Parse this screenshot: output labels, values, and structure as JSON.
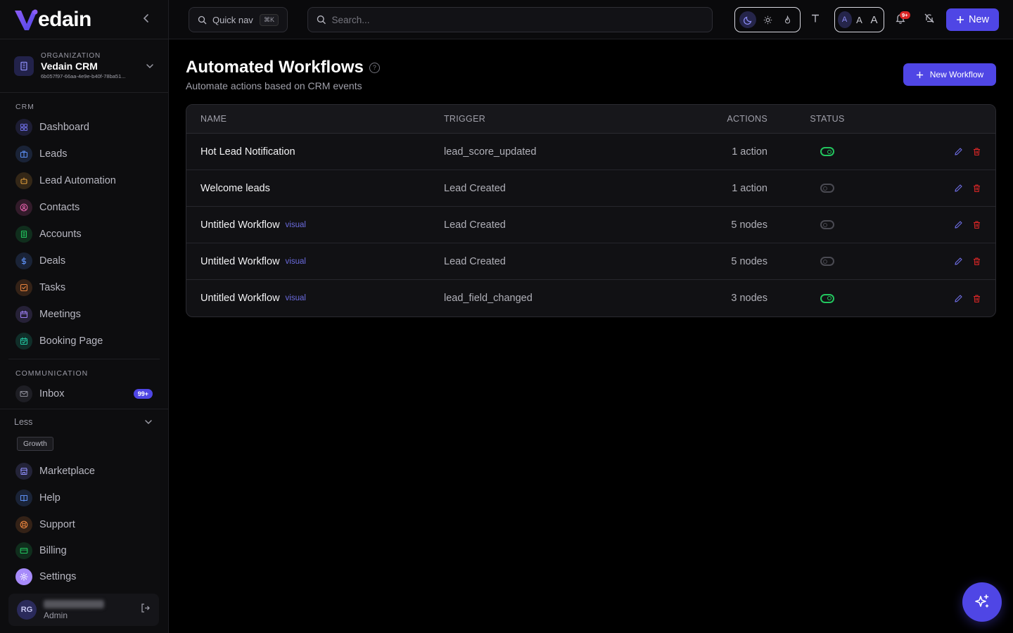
{
  "brand": {
    "name": "edain"
  },
  "organization": {
    "label": "ORGANIZATION",
    "name": "Vedain CRM",
    "id": "6b057f97-66aa-4e9e-b40f-78ba51..."
  },
  "sidebar": {
    "crm_label": "CRM",
    "crm_items": [
      {
        "label": "Dashboard",
        "icon": "grid-icon",
        "color": "#6b6bdf"
      },
      {
        "label": "Leads",
        "icon": "briefcase-icon",
        "color": "#5b8def"
      },
      {
        "label": "Lead Automation",
        "icon": "robot-icon",
        "color": "#e8a33d"
      },
      {
        "label": "Contacts",
        "icon": "user-circle-icon",
        "color": "#e05ea8"
      },
      {
        "label": "Accounts",
        "icon": "building-icon",
        "color": "#22c55e"
      },
      {
        "label": "Deals",
        "icon": "dollar-icon",
        "color": "#5b8def"
      },
      {
        "label": "Tasks",
        "icon": "checkbox-icon",
        "color": "#e8833d"
      },
      {
        "label": "Meetings",
        "icon": "calendar-icon",
        "color": "#9b7df0"
      },
      {
        "label": "Booking Page",
        "icon": "calendar-check-icon",
        "color": "#22c5a0"
      }
    ],
    "comm_label": "COMMUNICATION",
    "inbox": {
      "label": "Inbox",
      "badge": "99+",
      "color": "#8a8a95"
    },
    "less_label": "Less",
    "tag": "Growth",
    "bottom_items": [
      {
        "label": "Marketplace",
        "icon": "store-icon",
        "color": "#8b8bf5"
      },
      {
        "label": "Help",
        "icon": "book-icon",
        "color": "#5b8def"
      },
      {
        "label": "Support",
        "icon": "lifebuoy-icon",
        "color": "#e8833d"
      },
      {
        "label": "Billing",
        "icon": "credit-card-icon",
        "color": "#22c55e"
      },
      {
        "label": "Settings",
        "icon": "gear-icon",
        "color": "#a78bfa"
      }
    ],
    "user": {
      "initials": "RG",
      "role": "Admin"
    }
  },
  "topbar": {
    "quicknav_label": "Quick nav",
    "quicknav_kbd": "⌘K",
    "search_placeholder": "Search...",
    "size_options": [
      "A",
      "A",
      "A"
    ],
    "bell_badge": "9+",
    "new_label": "New"
  },
  "page": {
    "title": "Automated Workflows",
    "subtitle": "Automate actions based on CRM events",
    "new_workflow_label": "New Workflow"
  },
  "table": {
    "columns": {
      "name": "NAME",
      "trigger": "TRIGGER",
      "actions": "ACTIONS",
      "status": "STATUS"
    },
    "rows": [
      {
        "name": "Hot Lead Notification",
        "tag": "",
        "trigger": "lead_score_updated",
        "actions": "1 action",
        "enabled": true
      },
      {
        "name": "Welcome leads",
        "tag": "",
        "trigger": "Lead Created",
        "actions": "1 action",
        "enabled": false
      },
      {
        "name": "Untitled Workflow",
        "tag": "visual",
        "trigger": "Lead Created",
        "actions": "5 nodes",
        "enabled": false
      },
      {
        "name": "Untitled Workflow",
        "tag": "visual",
        "trigger": "Lead Created",
        "actions": "5 nodes",
        "enabled": false
      },
      {
        "name": "Untitled Workflow",
        "tag": "visual",
        "trigger": "lead_field_changed",
        "actions": "3 nodes",
        "enabled": true
      }
    ]
  },
  "colors": {
    "accent": "#4f46e5",
    "toggle_on": "#22c55e",
    "delete": "#dc2626",
    "edit": "#6b6bdf"
  }
}
